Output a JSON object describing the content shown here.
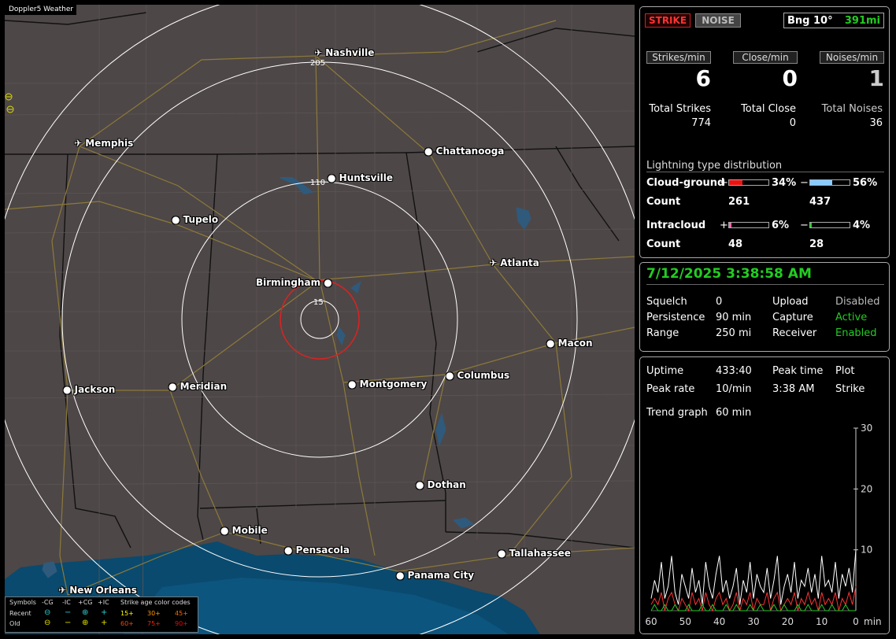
{
  "app_title": "Doppler5 Weather",
  "map": {
    "rings": [
      "15",
      "110",
      "205"
    ],
    "cities": [
      {
        "name": "Nashville",
        "icon": "airport-icon"
      },
      {
        "name": "Memphis",
        "icon": "airport-icon"
      },
      {
        "name": "Chattanooga",
        "icon": "city-dot-icon"
      },
      {
        "name": "Huntsville",
        "icon": "city-dot-icon"
      },
      {
        "name": "Tupelo",
        "icon": "city-dot-icon"
      },
      {
        "name": "Atlanta",
        "icon": "airport-icon"
      },
      {
        "name": "Birmingham",
        "icon": "city-dot-icon"
      },
      {
        "name": "Macon",
        "icon": "city-dot-icon"
      },
      {
        "name": "Jackson",
        "icon": "city-dot-icon"
      },
      {
        "name": "Meridian",
        "icon": "city-dot-icon"
      },
      {
        "name": "Montgomery",
        "icon": "city-dot-icon"
      },
      {
        "name": "Columbus",
        "icon": "city-dot-icon"
      },
      {
        "name": "Dothan",
        "icon": "city-dot-icon"
      },
      {
        "name": "Mobile",
        "icon": "city-dot-icon"
      },
      {
        "name": "Pensacola",
        "icon": "city-dot-icon"
      },
      {
        "name": "Tallahassee",
        "icon": "city-dot-icon"
      },
      {
        "name": "Panama City",
        "icon": "city-dot-icon"
      },
      {
        "name": "New Orleans",
        "icon": "airport-icon"
      }
    ]
  },
  "legend": {
    "symbols_label": "Symbols",
    "col_neg_cg": "-CG",
    "col_neg_ic": "-IC",
    "col_pos_cg": "+CG",
    "col_pos_ic": "+IC",
    "age_title": "Strike age color codes",
    "recent_label": "Recent",
    "old_label": "Old",
    "recent_ages": [
      "15+",
      "30+",
      "45+"
    ],
    "old_ages": [
      "60+",
      "75+",
      "90+"
    ],
    "age_colors": [
      "#ffff00",
      "#ff9900",
      "#ff6600",
      "#ff4400",
      "#ff2200",
      "#ff0000"
    ]
  },
  "top_panel": {
    "strike_button": "STRIKE",
    "noise_button": "NOISE",
    "bearing_label": "Bng 10°",
    "bearing_distance": "391mi",
    "rate_labels": [
      "Strikes/min",
      "Close/min",
      "Noises/min"
    ],
    "rate_values": [
      "6",
      "0",
      "1"
    ],
    "total_labels": [
      "Total Strikes",
      "Total Close",
      "Total Noises"
    ],
    "total_values": [
      "774",
      "0",
      "36"
    ],
    "dist_title": "Lightning type distribution",
    "cg_label": "Cloud-ground",
    "ic_label": "Intracloud",
    "count_label": "Count",
    "plus": "+",
    "minus": "−",
    "cg_pos_pct": "34%",
    "cg_neg_pct": "56%",
    "cg_pos_count": "261",
    "cg_neg_count": "437",
    "ic_pos_pct": "6%",
    "ic_neg_pct": "4%",
    "ic_pos_count": "48",
    "ic_neg_count": "28",
    "cg_pos_frac": 0.34,
    "cg_neg_frac": 0.56,
    "ic_pos_frac": 0.06,
    "ic_neg_frac": 0.04,
    "bar_colors": {
      "cg_pos": "#ee1111",
      "cg_neg": "#88ccff",
      "ic_pos": "#ff66aa",
      "ic_neg": "#22cc22"
    }
  },
  "status_panel": {
    "datetime": "7/12/2025 3:38:58 AM",
    "squelch_label": "Squelch",
    "squelch_value": "0",
    "persistence_label": "Persistence",
    "persistence_value": "90 min",
    "range_label": "Range",
    "range_value": "250 mi",
    "upload_label": "Upload",
    "upload_value": "Disabled",
    "capture_label": "Capture",
    "capture_value": "Active",
    "receiver_label": "Receiver",
    "receiver_value": "Enabled"
  },
  "stats_panel": {
    "uptime_label": "Uptime",
    "uptime_value": "433:40",
    "peak_time_label": "Peak time",
    "peak_time_value": "3:38 AM",
    "plot_label": "Plot",
    "plot_value": "Strike",
    "peak_rate_label": "Peak rate",
    "peak_rate_value": "10/min",
    "trend_label": "Trend graph",
    "trend_value": "60 min"
  },
  "chart_data": {
    "type": "line",
    "x_ticks": [
      "60",
      "50",
      "40",
      "30",
      "20",
      "10",
      "0"
    ],
    "x_unit": "min",
    "y_ticks": [
      "30",
      "20",
      "10"
    ],
    "xlim": [
      60,
      0
    ],
    "ylim": [
      0,
      30
    ],
    "x": [
      60,
      59,
      58,
      57,
      56,
      55,
      54,
      53,
      52,
      51,
      50,
      49,
      48,
      47,
      46,
      45,
      44,
      43,
      42,
      41,
      40,
      39,
      38,
      37,
      36,
      35,
      34,
      33,
      32,
      31,
      30,
      29,
      28,
      27,
      26,
      25,
      24,
      23,
      22,
      21,
      20,
      19,
      18,
      17,
      16,
      15,
      14,
      13,
      12,
      11,
      10,
      9,
      8,
      7,
      6,
      5,
      4,
      3,
      2,
      1,
      0
    ],
    "series": [
      {
        "color": "#ffffff",
        "values": [
          2,
          5,
          3,
          8,
          2,
          4,
          9,
          3,
          1,
          6,
          4,
          2,
          7,
          3,
          5,
          1,
          8,
          4,
          2,
          6,
          9,
          3,
          5,
          2,
          4,
          7,
          1,
          5,
          3,
          8,
          2,
          6,
          4,
          3,
          7,
          2,
          5,
          9,
          1,
          4,
          6,
          3,
          8,
          2,
          5,
          4,
          7,
          3,
          6,
          2,
          9,
          4,
          5,
          3,
          8,
          2,
          6,
          4,
          7,
          3,
          10
        ]
      },
      {
        "color": "#ff3333",
        "values": [
          1,
          2,
          1,
          3,
          0,
          2,
          3,
          1,
          0,
          2,
          1,
          0,
          3,
          1,
          2,
          0,
          3,
          1,
          0,
          2,
          3,
          1,
          2,
          0,
          1,
          3,
          0,
          2,
          1,
          3,
          0,
          2,
          1,
          1,
          3,
          0,
          2,
          3,
          0,
          1,
          2,
          1,
          3,
          0,
          2,
          1,
          3,
          1,
          2,
          0,
          3,
          1,
          2,
          1,
          3,
          0,
          2,
          1,
          3,
          1,
          4
        ]
      },
      {
        "color": "#22cc22",
        "values": [
          0,
          1,
          0,
          0,
          1,
          0,
          0,
          1,
          0,
          0,
          0,
          1,
          0,
          0,
          0,
          1,
          0,
          0,
          1,
          0,
          0,
          0,
          1,
          0,
          0,
          1,
          0,
          0,
          0,
          1,
          0,
          0,
          1,
          0,
          0,
          0,
          1,
          0,
          0,
          1,
          0,
          0,
          0,
          1,
          0,
          0,
          1,
          0,
          0,
          0,
          1,
          0,
          0,
          1,
          0,
          0,
          0,
          1,
          0,
          0,
          0
        ]
      }
    ]
  }
}
